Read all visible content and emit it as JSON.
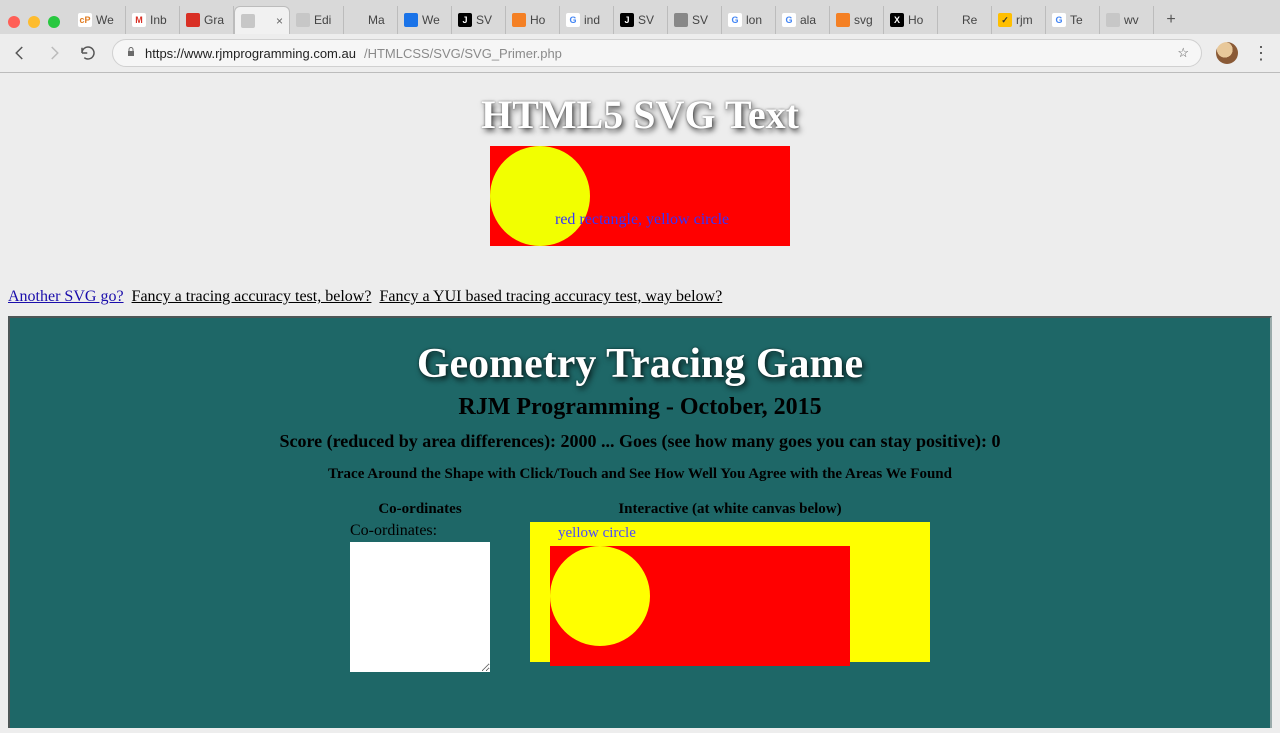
{
  "browser": {
    "tabs": [
      {
        "label": "We",
        "favBg": "#ffffff",
        "favTxt": "cP",
        "favColor": "#e07b1f"
      },
      {
        "label": "Inb",
        "favBg": "#ffffff",
        "favTxt": "M",
        "favColor": "#d93025"
      },
      {
        "label": "Gra",
        "favBg": "#d93025",
        "favTxt": "",
        "favColor": "#fff"
      },
      {
        "label": "",
        "favBg": "#c7c7c7",
        "favTxt": "",
        "favColor": "#fff",
        "active": true
      },
      {
        "label": "Edi",
        "favBg": "#c7c7c7",
        "favTxt": "",
        "favColor": "#fff"
      },
      {
        "label": "Ma",
        "favBg": "#ffffff",
        "favTxt": "",
        "favColor": "#555"
      },
      {
        "label": "We",
        "favBg": "#1a73e8",
        "favTxt": "",
        "favColor": "#fff"
      },
      {
        "label": "SV",
        "favBg": "#000000",
        "favTxt": "J",
        "favColor": "#fff"
      },
      {
        "label": "Ho",
        "favBg": "#f48024",
        "favTxt": "",
        "favColor": "#fff"
      },
      {
        "label": "ind",
        "favBg": "#ffffff",
        "favTxt": "G",
        "favColor": "#4285f4"
      },
      {
        "label": "SV",
        "favBg": "#000000",
        "favTxt": "J",
        "favColor": "#fff"
      },
      {
        "label": "SV",
        "favBg": "#888888",
        "favTxt": "",
        "favColor": "#fff"
      },
      {
        "label": "lon",
        "favBg": "#ffffff",
        "favTxt": "G",
        "favColor": "#4285f4"
      },
      {
        "label": "ala",
        "favBg": "#ffffff",
        "favTxt": "G",
        "favColor": "#4285f4"
      },
      {
        "label": "svg",
        "favBg": "#f48024",
        "favTxt": "",
        "favColor": "#fff"
      },
      {
        "label": "Ho",
        "favBg": "#000000",
        "favTxt": "X",
        "favColor": "#fff"
      },
      {
        "label": "Re",
        "favBg": "#ffffff",
        "favTxt": "",
        "favColor": "#555"
      },
      {
        "label": "rjm",
        "favBg": "#ffbf00",
        "favTxt": "✓",
        "favColor": "#333"
      },
      {
        "label": "Te",
        "favBg": "#ffffff",
        "favTxt": "G",
        "favColor": "#4285f4"
      },
      {
        "label": "wv",
        "favBg": "#c7c7c7",
        "favTxt": "",
        "favColor": "#fff"
      }
    ],
    "url_secure_host": "https://www.rjmprogramming.com.au",
    "url_path": "/HTMLCSS/SVG/SVG_Primer.php"
  },
  "topSection": {
    "title": "HTML5 SVG Text",
    "svgText": "red rectangle, yellow circle"
  },
  "linksRow": {
    "link1": "Another SVG go?",
    "link2": "Fancy a tracing accuracy test, below?",
    "link3": "Fancy a YUI based tracing accuracy test, way below?"
  },
  "game": {
    "title": "Geometry Tracing Game",
    "subtitle": "RJM Programming - October, 2015",
    "scoreLine": "Score (reduced by area differences): 2000 ... Goes (see how many goes you can stay positive): 0",
    "instruction": "Trace Around the Shape with Click/Touch and See How Well You Agree with the Areas We Found",
    "colCoords": "Co-ordinates",
    "colInteractive": "Interactive (at white canvas below)",
    "coordsLabel": "Co-ordinates:",
    "canvasText": "yellow circle"
  }
}
